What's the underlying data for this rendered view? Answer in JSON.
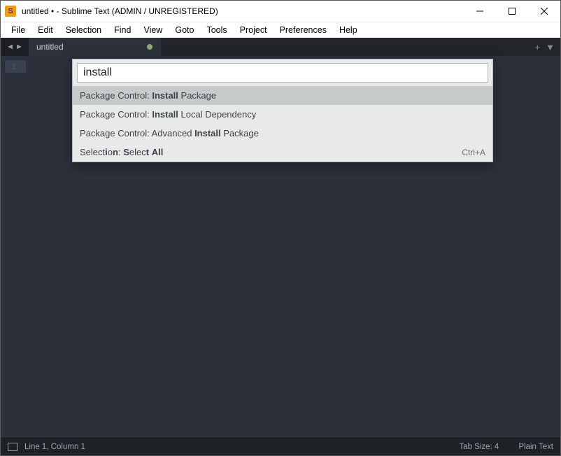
{
  "titlebar": {
    "title": "untitled • - Sublime Text (ADMIN / UNREGISTERED)"
  },
  "menubar": {
    "items": [
      "File",
      "Edit",
      "Selection",
      "Find",
      "View",
      "Goto",
      "Tools",
      "Project",
      "Preferences",
      "Help"
    ]
  },
  "tabs": {
    "current": {
      "name": "untitled",
      "dirty": true
    }
  },
  "gutter": {
    "line1": "1"
  },
  "palette": {
    "query": "install",
    "items": [
      {
        "html": "Package Control: <b>Install</b> Package",
        "shortcut": ""
      },
      {
        "html": "Package Control: <b>Install</b> Local Dependency",
        "shortcut": ""
      },
      {
        "html": "Package Control: Advanced <b>Install</b> Package",
        "shortcut": ""
      },
      {
        "html": "Select<b>i</b>o<b>n</b>: <b>S</b>elec<b>t</b> <b>All</b>",
        "shortcut": "Ctrl+A"
      }
    ]
  },
  "statusbar": {
    "position": "Line 1, Column 1",
    "tabsize": "Tab Size: 4",
    "syntax": "Plain Text"
  }
}
